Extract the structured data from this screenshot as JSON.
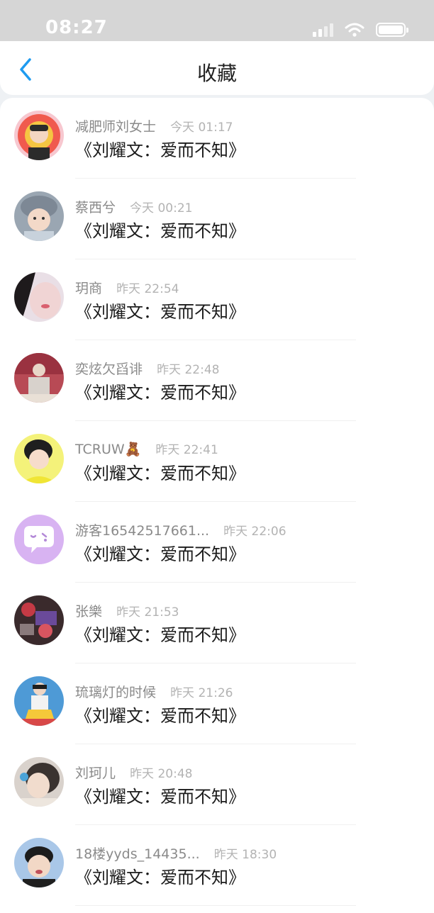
{
  "status_bar": {
    "time": "08:27"
  },
  "header": {
    "title": "收藏"
  },
  "items": [
    {
      "name": "减肥师刘女士",
      "time": "今天 01:17",
      "title": "《刘耀文：爱而不知》"
    },
    {
      "name": "蔡西兮",
      "time": "今天 00:21",
      "title": "《刘耀文：爱而不知》"
    },
    {
      "name": "玥商",
      "time": "昨天 22:54",
      "title": "《刘耀文：爱而不知》"
    },
    {
      "name": "奕炫欠舀诽",
      "time": "昨天 22:48",
      "title": "《刘耀文：爱而不知》"
    },
    {
      "name": "TCRUW🧸",
      "time": "昨天 22:41",
      "title": "《刘耀文：爱而不知》"
    },
    {
      "name": "游客16542517661...",
      "time": "昨天 22:06",
      "title": "《刘耀文：爱而不知》"
    },
    {
      "name": "张樂",
      "time": "昨天 21:53",
      "title": "《刘耀文：爱而不知》"
    },
    {
      "name": "琉璃灯的时候",
      "time": "昨天 21:26",
      "title": "《刘耀文：爱而不知》"
    },
    {
      "name": "刘珂儿",
      "time": "昨天 20:48",
      "title": "《刘耀文：爱而不知》"
    },
    {
      "name": "18楼yyds_14435...",
      "time": "昨天 18:30",
      "title": "《刘耀文：爱而不知》"
    }
  ],
  "colors": {
    "accent": "#1e9bf0",
    "status_bar_bg": "#d6d6d6",
    "page_bg": "#eef1f4"
  },
  "icons": {
    "back": "chevron-left-icon",
    "signal": "signal-icon",
    "wifi": "wifi-icon",
    "battery": "battery-icon",
    "guest_avatar": "chat-bubble-icon"
  }
}
